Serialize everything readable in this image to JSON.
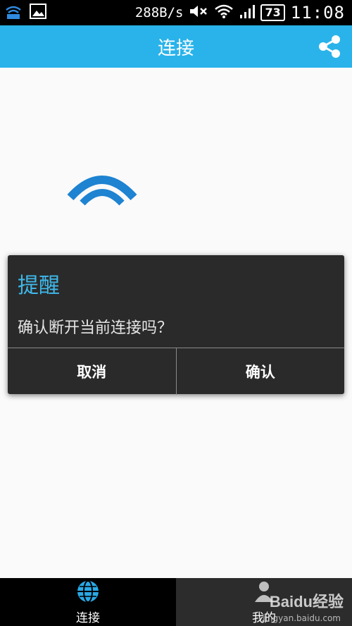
{
  "status_bar": {
    "speed": "288B/s",
    "battery": "73",
    "time": "11:08"
  },
  "header": {
    "title": "连接"
  },
  "dialog": {
    "title": "提醒",
    "message": "确认断开当前连接吗？",
    "cancel_label": "取消",
    "confirm_label": "确认"
  },
  "bottom_nav": {
    "tabs": [
      {
        "label": "连接",
        "icon": "globe-icon",
        "active": true
      },
      {
        "label": "我的",
        "icon": "person-icon",
        "active": false
      }
    ]
  },
  "watermark": {
    "text": "Baidu经验",
    "sub": "jingyan.baidu.com"
  },
  "colors": {
    "accent": "#29b3ea",
    "dialog_bg": "#2a2a2a",
    "dialog_title": "#3fb8ea"
  }
}
